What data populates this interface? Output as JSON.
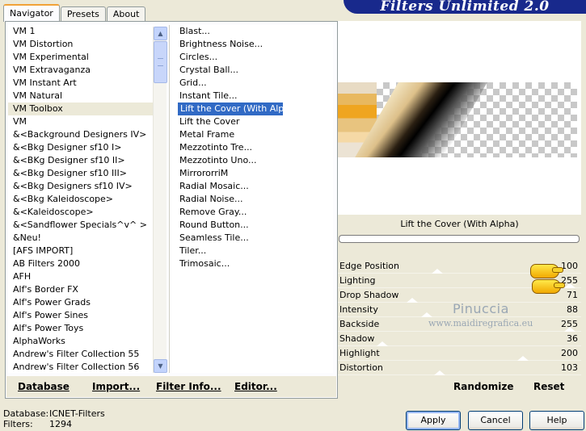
{
  "title": "Filters Unlimited 2.0",
  "tabs": [
    "Navigator",
    "Presets",
    "About"
  ],
  "categories": [
    "VM 1",
    "VM Distortion",
    "VM Experimental",
    "VM Extravaganza",
    "VM Instant Art",
    "VM Natural",
    "VM Toolbox",
    "VM",
    "&<Background Designers IV>",
    "&<Bkg Designer sf10 I>",
    "&<BKg Designer sf10 II>",
    "&<Bkg Designer sf10 III>",
    "&<Bkg Designers sf10 IV>",
    "&<Bkg Kaleidoscope>",
    "&<Kaleidoscope>",
    "&<Sandflower Specials^v^ >",
    "&Neu!",
    "[AFS IMPORT]",
    "AB Filters 2000",
    "AFH",
    "Alf's Border FX",
    "Alf's Power Grads",
    "Alf's Power Sines",
    "Alf's Power Toys",
    "AlphaWorks",
    "Andrew's Filter Collection 55",
    "Andrew's Filter Collection 56"
  ],
  "selected_category": "VM Toolbox",
  "filters": [
    "Blast...",
    "Brightness Noise...",
    "Circles...",
    "Crystal Ball...",
    "Grid...",
    "Instant Tile...",
    "Lift the Cover (With Alpha)",
    "Lift the Cover",
    "Metal Frame",
    "Mezzotinto Tre...",
    "Mezzotinto Uno...",
    "MirrororriM",
    "Radial Mosaic...",
    "Radial Noise...",
    "Remove Gray...",
    "Round Button...",
    "Seamless Tile...",
    "Tiler...",
    "Trimosaic..."
  ],
  "selected_filter": "Lift the Cover (With Alpha)",
  "bottom_links": {
    "database": "Database",
    "import": "Import...",
    "filter_info": "Filter Info...",
    "editor": "Editor..."
  },
  "filter_name": "Lift the Cover (With Alpha)",
  "params": [
    {
      "name": "Edge Position",
      "value": "100",
      "level": 100
    },
    {
      "name": "Lighting",
      "value": "255",
      "level": 255
    },
    {
      "name": "Drop Shadow",
      "value": "71",
      "level": 71
    },
    {
      "name": "Intensity",
      "value": "88",
      "level": 88
    },
    {
      "name": "Backside",
      "value": "255",
      "level": 255
    },
    {
      "name": "Shadow",
      "value": "36",
      "level": 36
    },
    {
      "name": "Highlight",
      "value": "200",
      "level": 200
    },
    {
      "name": "Distortion",
      "value": "103",
      "level": 103
    }
  ],
  "watermark": {
    "name": "Pinuccia",
    "url": "www.maidiregrafica.eu"
  },
  "randomize": "Randomize",
  "reset": "Reset",
  "status": {
    "database_label": "Database:",
    "database_value": "ICNET-Filters",
    "filters_label": "Filters:",
    "filters_value": "1294"
  },
  "buttons": {
    "apply": "Apply",
    "cancel": "Cancel",
    "help": "Help"
  }
}
